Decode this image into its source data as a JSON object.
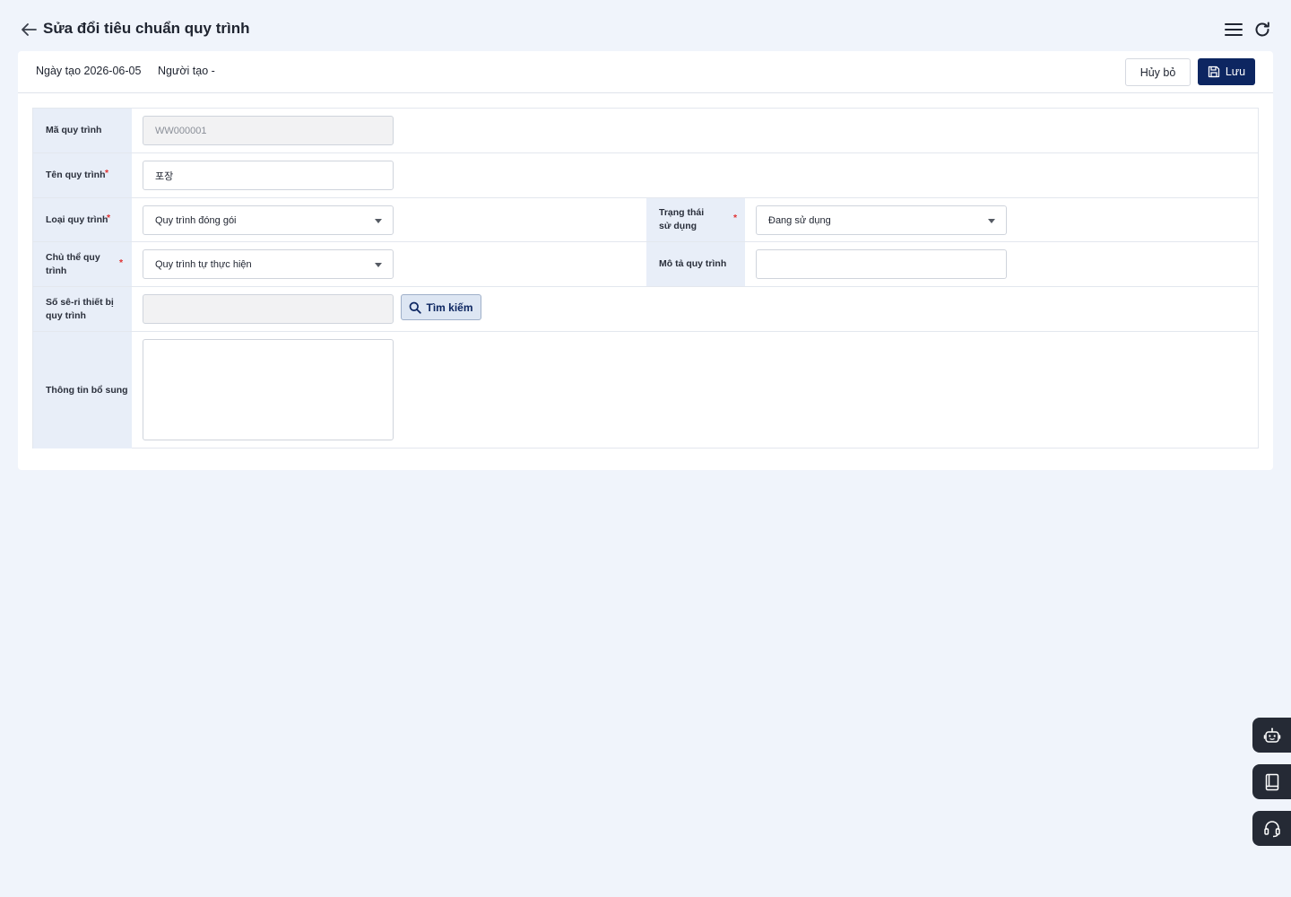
{
  "header": {
    "title": "Sửa đổi tiêu chuẩn quy trình"
  },
  "meta": {
    "created_date_label": "Ngày tạo 2026-06-05",
    "creator_label": "Người tạo -"
  },
  "actions": {
    "cancel_label": "Hủy bỏ",
    "save_label": "Lưu"
  },
  "form": {
    "process_code": {
      "label": "Mã quy trình",
      "value": "WW000001"
    },
    "process_name": {
      "label": "Tên quy trình",
      "value": "포장"
    },
    "process_type": {
      "label": "Loại quy trình",
      "value": "Quy trình đóng gói"
    },
    "usage_status": {
      "label": "Trạng thái sử dụng",
      "value": "Đang sử dụng"
    },
    "process_subject": {
      "label": "Chủ thể quy trình",
      "value": "Quy trình tự thực hiện"
    },
    "process_description": {
      "label": "Mô tả quy trình",
      "value": ""
    },
    "device_serial": {
      "label": "Số sê-ri thiết bị quy trình",
      "value": ""
    },
    "search_label": "Tìm kiếm",
    "additional_info": {
      "label": "Thông tin bổ sung",
      "value": ""
    },
    "required_mark": "*"
  },
  "colors": {
    "primary": "#0d2661",
    "label_bg": "#e8eef8",
    "page_bg": "#f0f4fb",
    "required": "#e03131"
  }
}
